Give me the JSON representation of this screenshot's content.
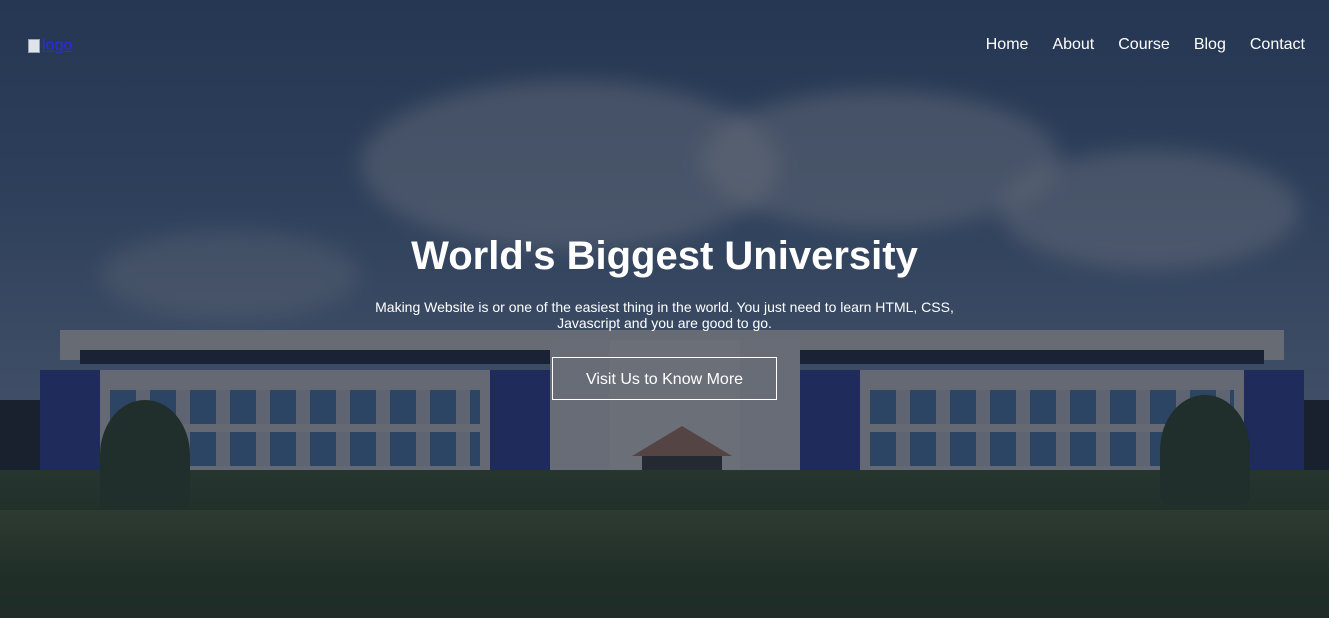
{
  "header": {
    "logo_alt": "logo",
    "nav": [
      {
        "label": "Home"
      },
      {
        "label": "About"
      },
      {
        "label": "Course"
      },
      {
        "label": "Blog"
      },
      {
        "label": "Contact"
      }
    ]
  },
  "hero": {
    "title": "World's Biggest University",
    "description": "Making Website is or one of the easiest thing in the world. You just need to learn HTML, CSS, Javascript and you are good to go.",
    "cta_label": "Visit Us to Know More"
  },
  "colors": {
    "overlay": "#181e2c",
    "text": "#ffffff",
    "link": "#2a2ae6"
  }
}
